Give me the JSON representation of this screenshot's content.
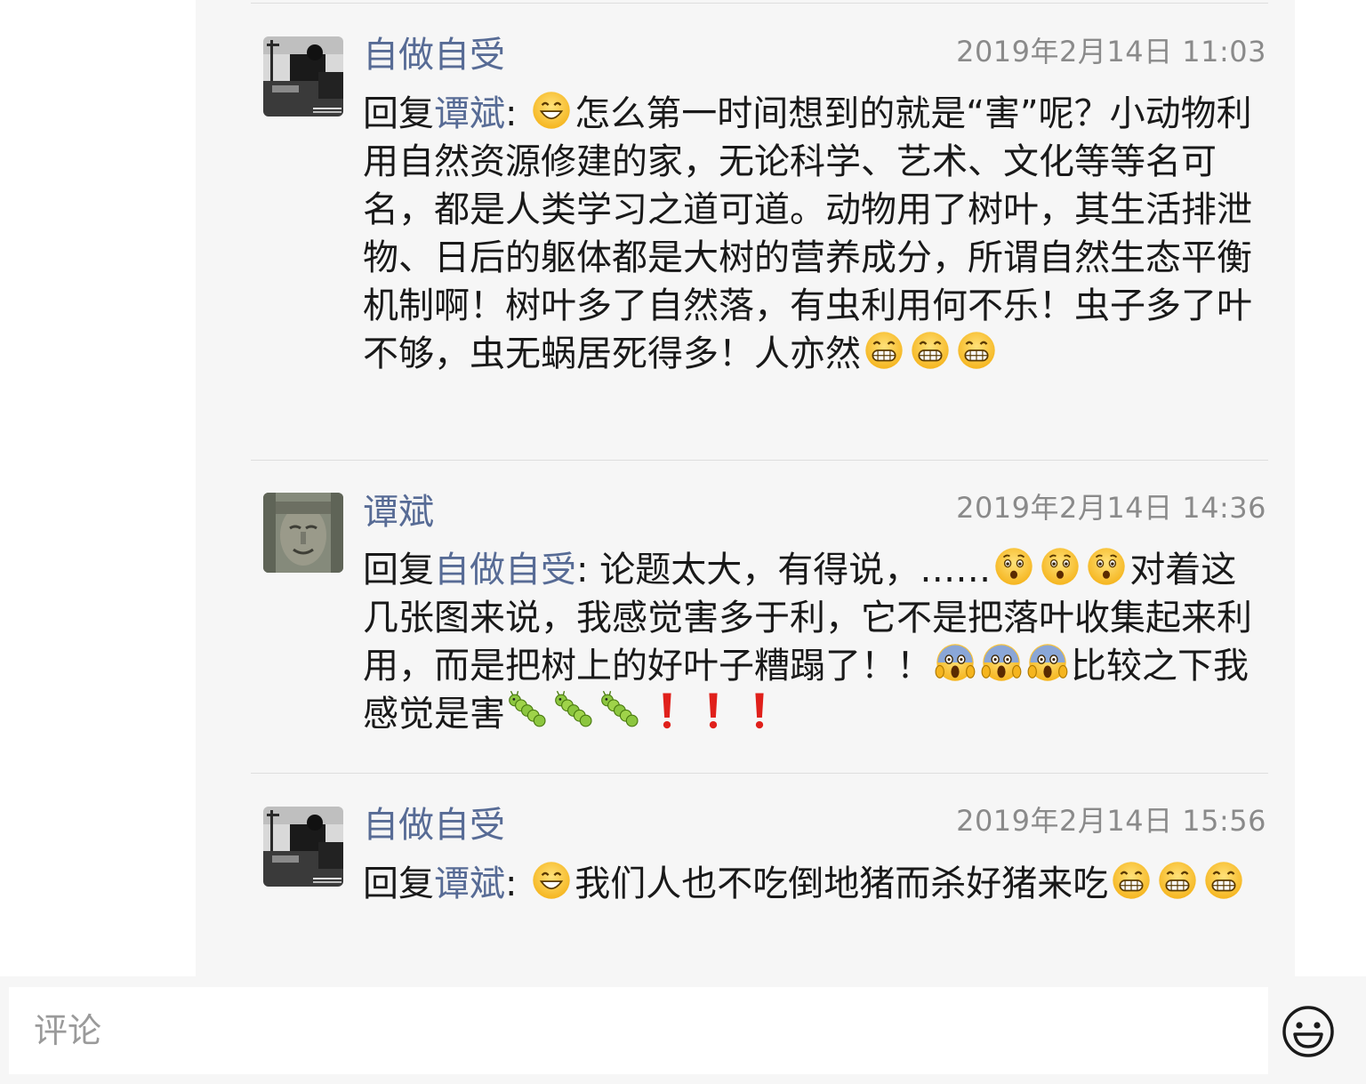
{
  "comments": [
    {
      "author": "自做自受",
      "timestamp": "2019年2月14日 11:03",
      "reply_prefix": "回复",
      "reply_to": "谭斌",
      "colon": ": ",
      "text": "怎么第一时间想到的就是“害”呢？小动物利用自然资源修建的家，无论科学、艺术、文化等等名可名，都是人类学习之道可道。动物用了树叶，其生活排泄物、日后的躯体都是大树的营养成分，所谓自然生态平衡机制啊！树叶多了自然落，有虫利用何不乐！虫子多了叶不够，虫无蜗居死得多！人亦然"
    },
    {
      "author": "谭斌",
      "timestamp": "2019年2月14日 14:36",
      "reply_prefix": "回复",
      "reply_to": "自做自受",
      "colon": ": ",
      "text_1": "论题太大，有得说，……",
      "text_2": "对着这几张图来说，我感觉害多于利，它不是把落叶收集起来利用，而是把树上的好叶子糟蹋了！！",
      "text_3": "比较之下我感觉是害"
    },
    {
      "author": "自做自受",
      "timestamp": "2019年2月14日 15:56",
      "reply_prefix": "回复",
      "reply_to": "谭斌",
      "colon": ": ",
      "text": "我们人也不吃倒地猪而杀好猪来吃"
    }
  ],
  "emoji_names": [
    "smile-emoji",
    "grin-emoji",
    "astonished-emoji",
    "scream-emoji",
    "caterpillar-emoji",
    "exclamation-emoji"
  ],
  "comment_input": {
    "placeholder": "评论",
    "value": ""
  },
  "colors": {
    "link": "#576b95",
    "panel_bg": "#f6f6f6",
    "timestamp": "#8a8a8a",
    "text": "#191919"
  }
}
